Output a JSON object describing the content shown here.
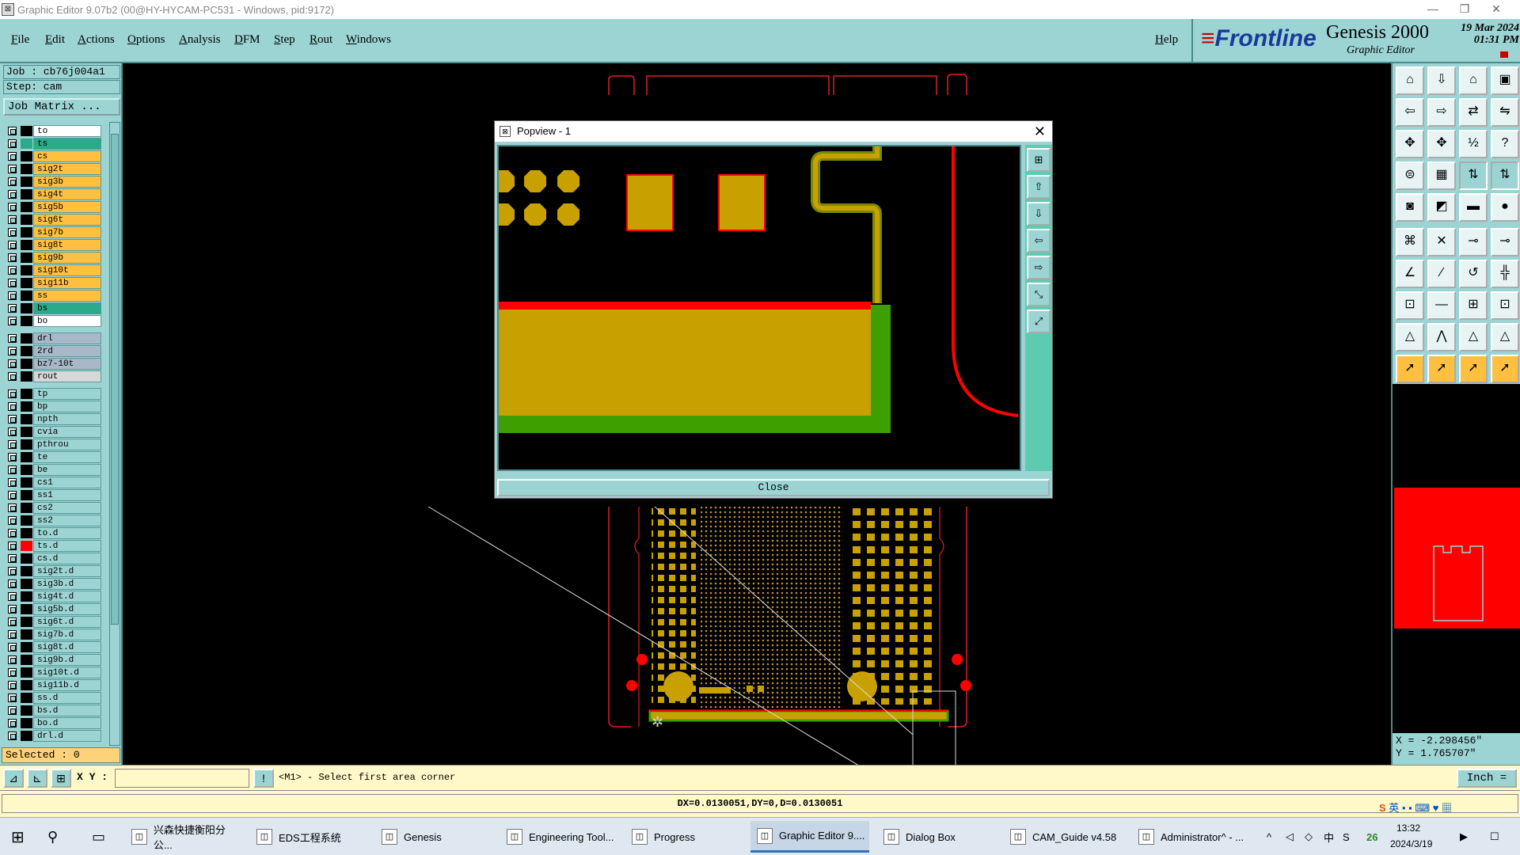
{
  "window": {
    "title": "Graphic Editor 9.07b2 (00@HY-HYCAM-PC531 - Windows, pid:9172)",
    "minimize": "—",
    "restore": "❐",
    "close": "✕"
  },
  "menu": {
    "items": [
      "File",
      "Edit",
      "Actions",
      "Options",
      "Analysis",
      "DFM",
      "Step",
      "Rout",
      "Windows"
    ],
    "help": "Help"
  },
  "brand": {
    "logo": "Frontline",
    "product": "Genesis 2000",
    "subtitle": "Graphic Editor",
    "date": "19 Mar 2024",
    "time": "01:31 PM"
  },
  "left_panel": {
    "job": "Job  : cb76j004a1",
    "step": "Step:  cam",
    "job_matrix": "Job Matrix ...",
    "selected": "Selected : 0",
    "layers": [
      {
        "name": "to",
        "color": "#ffffff",
        "mark": "#000000"
      },
      {
        "name": "ts",
        "color": "#2aaa8a",
        "mark": "#2aaa8a"
      },
      {
        "name": "cs",
        "color": "#ffc040",
        "mark": "#000000"
      },
      {
        "name": "sig2t",
        "color": "#ffc040",
        "mark": "#000000"
      },
      {
        "name": "sig3b",
        "color": "#ffc040",
        "mark": "#000000"
      },
      {
        "name": "sig4t",
        "color": "#ffc040",
        "mark": "#000000"
      },
      {
        "name": "sig5b",
        "color": "#ffc040",
        "mark": "#000000"
      },
      {
        "name": "sig6t",
        "color": "#ffc040",
        "mark": "#000000"
      },
      {
        "name": "sig7b",
        "color": "#ffc040",
        "mark": "#000000"
      },
      {
        "name": "sig8t",
        "color": "#ffc040",
        "mark": "#000000"
      },
      {
        "name": "sig9b",
        "color": "#ffc040",
        "mark": "#000000"
      },
      {
        "name": "sig10t",
        "color": "#ffc040",
        "mark": "#000000"
      },
      {
        "name": "sig11b",
        "color": "#ffc040",
        "mark": "#000000"
      },
      {
        "name": "ss",
        "color": "#ffc040",
        "mark": "#000000"
      },
      {
        "name": "bs",
        "color": "#2aaa8a",
        "mark": "#000000"
      },
      {
        "name": "bo",
        "color": "#ffffff",
        "mark": "#000000"
      },
      {
        "name": "drl",
        "color": "#a8b8c8",
        "mark": "#000000"
      },
      {
        "name": "2rd",
        "color": "#a8b8c8",
        "mark": "#000000"
      },
      {
        "name": "bz7-10t",
        "color": "#a8b8c8",
        "mark": "#000000"
      },
      {
        "name": "rout",
        "color": "#d8d8d8",
        "mark": "#000000"
      },
      {
        "name": "tp",
        "color": "#9cd4d4",
        "mark": "#000000"
      },
      {
        "name": "bp",
        "color": "#9cd4d4",
        "mark": "#000000"
      },
      {
        "name": "npth",
        "color": "#9cd4d4",
        "mark": "#000000"
      },
      {
        "name": "cvia",
        "color": "#9cd4d4",
        "mark": "#000000"
      },
      {
        "name": "pthrou",
        "color": "#9cd4d4",
        "mark": "#000000"
      },
      {
        "name": "te",
        "color": "#9cd4d4",
        "mark": "#000000"
      },
      {
        "name": "be",
        "color": "#9cd4d4",
        "mark": "#000000"
      },
      {
        "name": "cs1",
        "color": "#9cd4d4",
        "mark": "#000000"
      },
      {
        "name": "ss1",
        "color": "#9cd4d4",
        "mark": "#000000"
      },
      {
        "name": "cs2",
        "color": "#9cd4d4",
        "mark": "#000000"
      },
      {
        "name": "ss2",
        "color": "#9cd4d4",
        "mark": "#000000"
      },
      {
        "name": "to.d",
        "color": "#9cd4d4",
        "mark": "#000000"
      },
      {
        "name": "ts.d",
        "color": "#9cd4d4",
        "mark": "#ff0000"
      },
      {
        "name": "cs.d",
        "color": "#9cd4d4",
        "mark": "#000000"
      },
      {
        "name": "sig2t.d",
        "color": "#9cd4d4",
        "mark": "#000000"
      },
      {
        "name": "sig3b.d",
        "color": "#9cd4d4",
        "mark": "#000000"
      },
      {
        "name": "sig4t.d",
        "color": "#9cd4d4",
        "mark": "#000000"
      },
      {
        "name": "sig5b.d",
        "color": "#9cd4d4",
        "mark": "#000000"
      },
      {
        "name": "sig6t.d",
        "color": "#9cd4d4",
        "mark": "#000000"
      },
      {
        "name": "sig7b.d",
        "color": "#9cd4d4",
        "mark": "#000000"
      },
      {
        "name": "sig8t.d",
        "color": "#9cd4d4",
        "mark": "#000000"
      },
      {
        "name": "sig9b.d",
        "color": "#9cd4d4",
        "mark": "#000000"
      },
      {
        "name": "sig10t.d",
        "color": "#9cd4d4",
        "mark": "#000000"
      },
      {
        "name": "sig11b.d",
        "color": "#9cd4d4",
        "mark": "#000000"
      },
      {
        "name": "ss.d",
        "color": "#9cd4d4",
        "mark": "#000000"
      },
      {
        "name": "bs.d",
        "color": "#9cd4d4",
        "mark": "#000000"
      },
      {
        "name": "bo.d",
        "color": "#9cd4d4",
        "mark": "#000000"
      },
      {
        "name": "drl.d",
        "color": "#9cd4d4",
        "mark": "#000000"
      }
    ]
  },
  "popview": {
    "title": "Popview - 1",
    "close_label": "Close"
  },
  "coords": {
    "x": "X = -2.298456\"",
    "y": "Y =  1.765707\""
  },
  "command": {
    "xy_label": "X Y :",
    "prompt": "<M1> - Select first area corner",
    "unit": "Inch ="
  },
  "status": {
    "text": "DX=0.0130051,DY=0,D=0.0130051"
  },
  "taskbar": {
    "items": [
      "兴森快捷衡阳分公...",
      "EDS工程系统",
      "Genesis",
      "Engineering Tool...",
      "Progress",
      "Graphic Editor 9....",
      "Dialog Box",
      "CAM_Guide v4.58",
      "Administrator^ - ..."
    ],
    "tray_lang": "英",
    "tray_ime": "中",
    "tray_badge": "26",
    "time": "13:32",
    "date": "2024/3/19"
  },
  "colors": {
    "panel": "#9cd4d4",
    "copper": "#c8a000",
    "red": "#ff0000",
    "green": "#3ea000"
  }
}
